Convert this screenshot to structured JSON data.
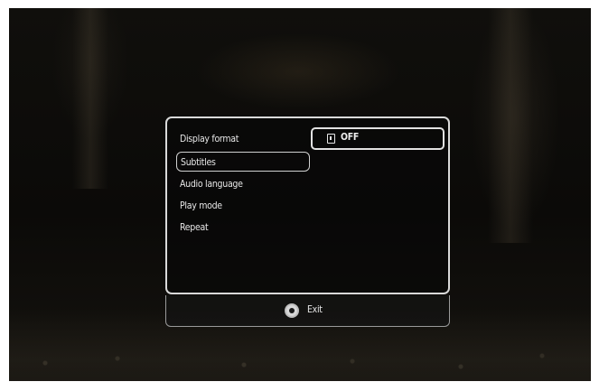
{
  "menu": {
    "items": [
      {
        "label": "Display format"
      },
      {
        "label": "Subtitles",
        "selected": true
      },
      {
        "label": "Audio language"
      },
      {
        "label": "Play mode"
      },
      {
        "label": "Repeat"
      }
    ],
    "option": {
      "icon": "subtitle-off-icon",
      "value": "OFF"
    }
  },
  "footer": {
    "icon": "exit-button-icon",
    "exit_label": "Exit"
  },
  "colors": {
    "border": "#d9d9d9",
    "text": "#e6e6e6",
    "background": "#0d0c0a"
  }
}
